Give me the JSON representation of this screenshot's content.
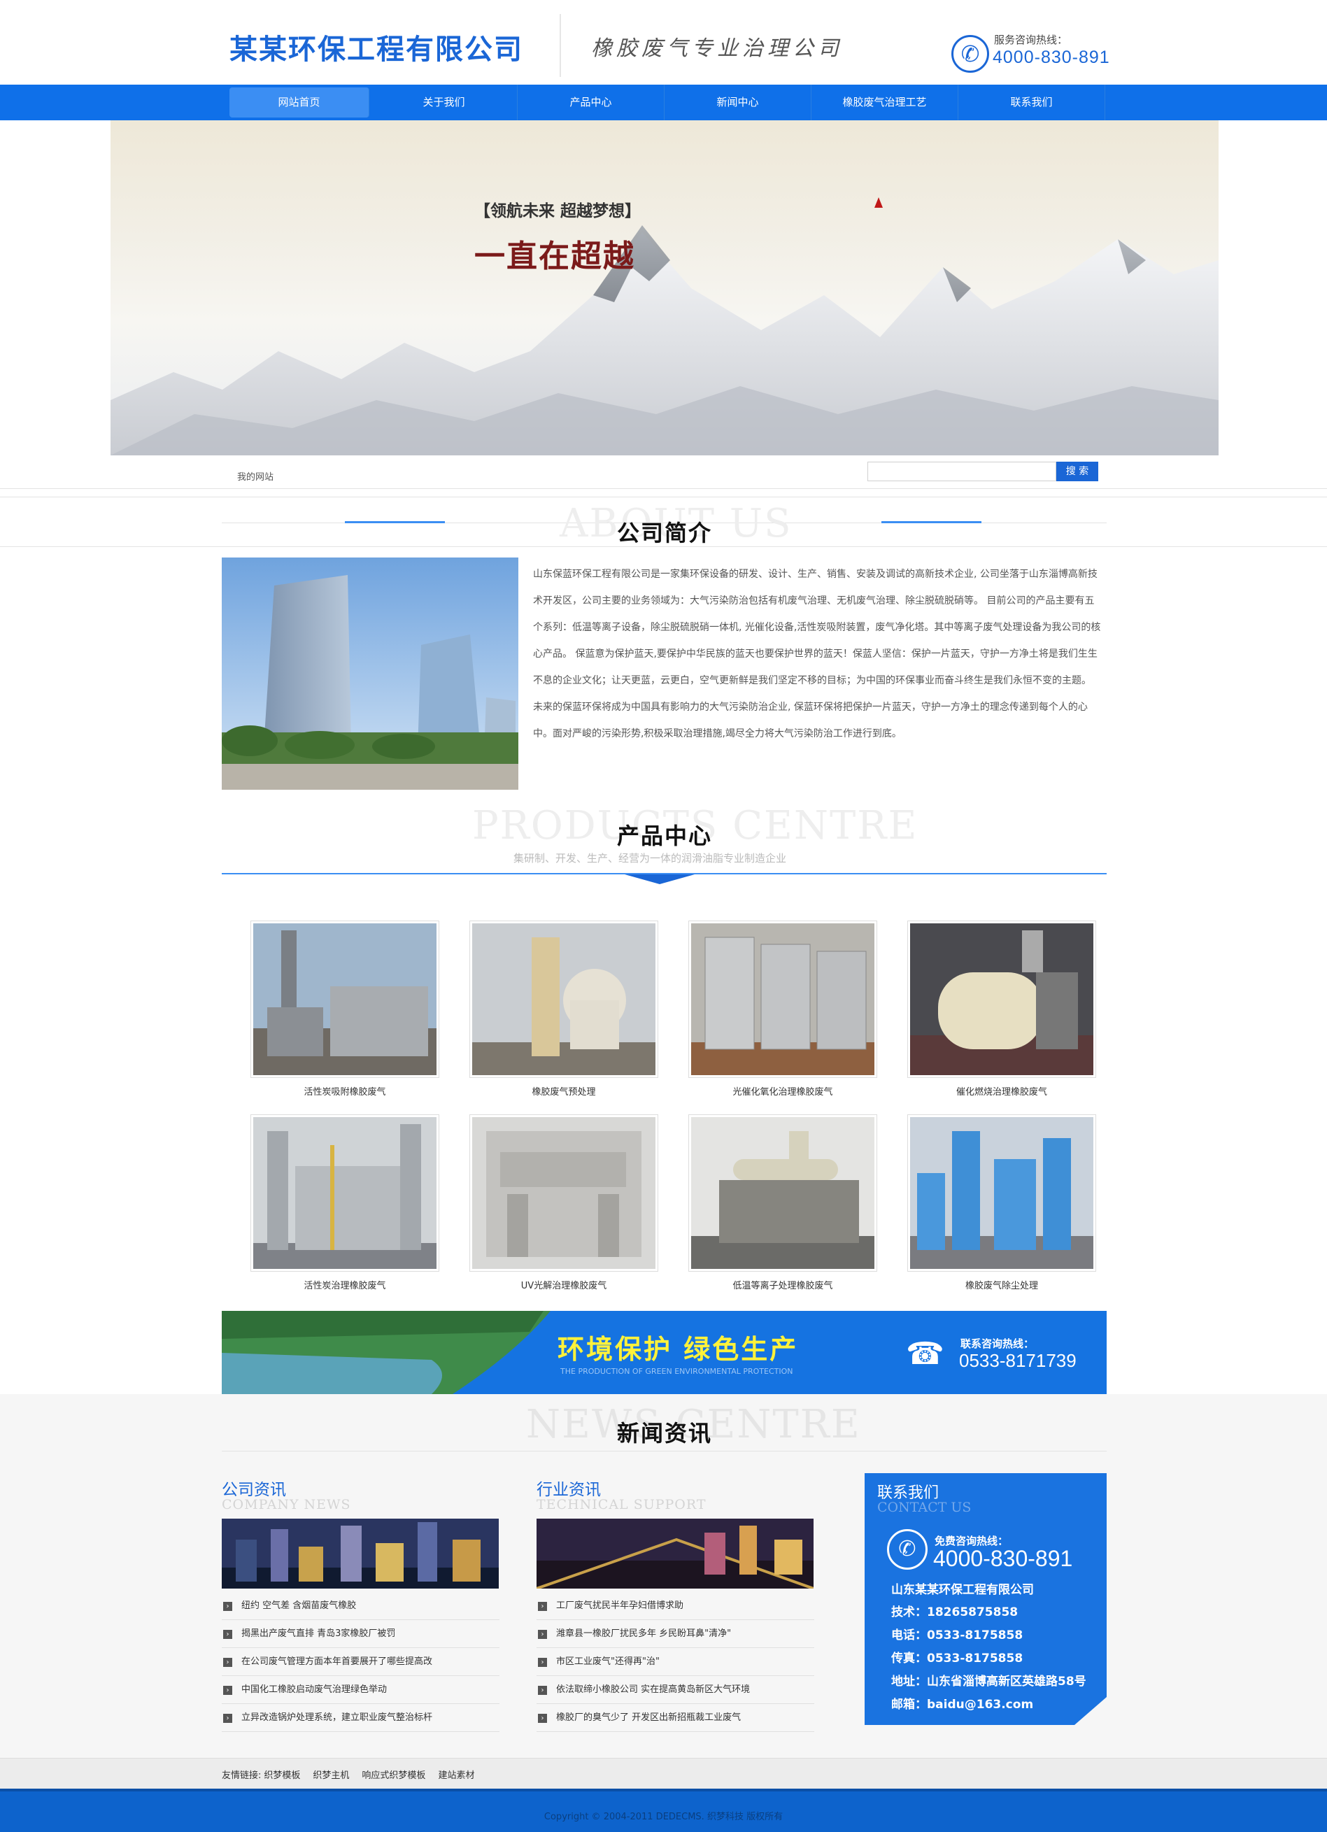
{
  "header": {
    "company_name": "某某环保工程有限公司",
    "slogan": "橡胶废气专业治理公司",
    "hotline_label": "服务咨询热线：",
    "hotline_number": "4000-830-891"
  },
  "nav": {
    "items": [
      {
        "label": "网站首页",
        "active": true
      },
      {
        "label": "关于我们"
      },
      {
        "label": "产品中心"
      },
      {
        "label": "新闻中心"
      },
      {
        "label": "橡胶废气治理工艺"
      },
      {
        "label": "联系我们"
      }
    ]
  },
  "banner": {
    "tagline": "【领航未来 超越梦想】",
    "headline": "一直在超越"
  },
  "search": {
    "breadcrumb": "我的网站",
    "placeholder": "",
    "button_label": "搜 索"
  },
  "about": {
    "ghost": "ABOUT US",
    "title": "公司简介",
    "text": "山东保蓝环保工程有限公司是一家集环保设备的研发、设计、生产、销售、安装及调试的高新技术企业, 公司坐落于山东淄博高新技术开发区，公司主要的业务领域为：大气污染防治包括有机废气治理、无机废气治理、除尘脱硫脱硝等。 目前公司的产品主要有五个系列：低温等离子设备，除尘脱硫脱硝一体机, 光催化设备,活性炭吸附装置，废气净化塔。其中等离子废气处理设备为我公司的核心产品。 保蓝意为保护蓝天,要保护中华民族的蓝天也要保护世界的蓝天！保蓝人坚信：保护一片蓝天，守护一方净土将是我们生生不息的企业文化；让天更蓝，云更白，空气更新鲜是我们坚定不移的目标；为中国的环保事业而奋斗终生是我们永恒不变的主题。 未来的保蓝环保将成为中国具有影响力的大气污染防治企业, 保蓝环保将把保护一片蓝天，守护一方净土的理念传递到每个人的心中。面对严峻的污染形势,积极采取治理措施,竭尽全力将大气污染防治工作进行到底。"
  },
  "products": {
    "ghost": "PRODUCTS CENTRE",
    "title": "产品中心",
    "subtitle": "集研制、开发、生产、经营为一体的润滑油脂专业制造企业",
    "items": [
      {
        "label": "活性炭吸附橡胶废气"
      },
      {
        "label": "橡胶废气预处理"
      },
      {
        "label": "光催化氧化治理橡胶废气"
      },
      {
        "label": "催化燃烧治理橡胶废气"
      },
      {
        "label": "活性炭治理橡胶废气"
      },
      {
        "label": "UV光解治理橡胶废气"
      },
      {
        "label": "低温等离子处理橡胶废气"
      },
      {
        "label": "橡胶废气除尘处理"
      }
    ]
  },
  "promo": {
    "headline": "环境保护  绿色生产",
    "subline": "THE PRODUCTION OF GREEN ENVIRONMENTAL PROTECTION",
    "hotline_label": "联系咨询热线：",
    "hotline_number": "0533-8171739"
  },
  "news": {
    "ghost": "NEWS CENTRE",
    "title": "新闻资讯",
    "company": {
      "title": "公司资讯",
      "sub": "COMPANY NEWS",
      "items": [
        "纽约 空气差 含烟苗废气橡胶",
        "揭黑出产废气直排 青岛3家橡胶厂被罚",
        "在公司废气管理方面本年首要展开了哪些提高改",
        "中国化工橡胶启动废气治理绿色举动",
        "立异改造锅炉处理系统，建立职业废气整治标杆"
      ]
    },
    "industry": {
      "title": "行业资讯",
      "sub": "TECHNICAL SUPPORT",
      "items": [
        "工厂废气扰民半年孕妇借博求助",
        "潍章县一橡胶厂扰民多年 乡民盼耳鼻\"清净\"",
        "市区工业废气\"还得再\"治\"",
        "依法取缔小橡胶公司 实在提高黄岛新区大气环境",
        "橡胶厂的臭气少了 开发区出新招瓶裁工业废气"
      ]
    },
    "contact": {
      "title": "联系我们",
      "sub": "CONTACT US",
      "hotline_label": "免费咨询热线：",
      "hotline_number": "4000-830-891",
      "company": "山东某某环保工程有限公司",
      "lines": [
        "技术：18265875858",
        "电话：0533-8175858",
        "传真：0533-8175858",
        "地址：山东省淄博高新区英雄路58号",
        "邮箱：baidu@163.com"
      ]
    }
  },
  "footer": {
    "links_label": "友情链接:",
    "links": [
      "织梦模板",
      "织梦主机",
      "响应式织梦模板",
      "建站素材"
    ],
    "copyright": "Copyright © 2004-2011 DEDECMS. 织梦科技 版权所有"
  }
}
